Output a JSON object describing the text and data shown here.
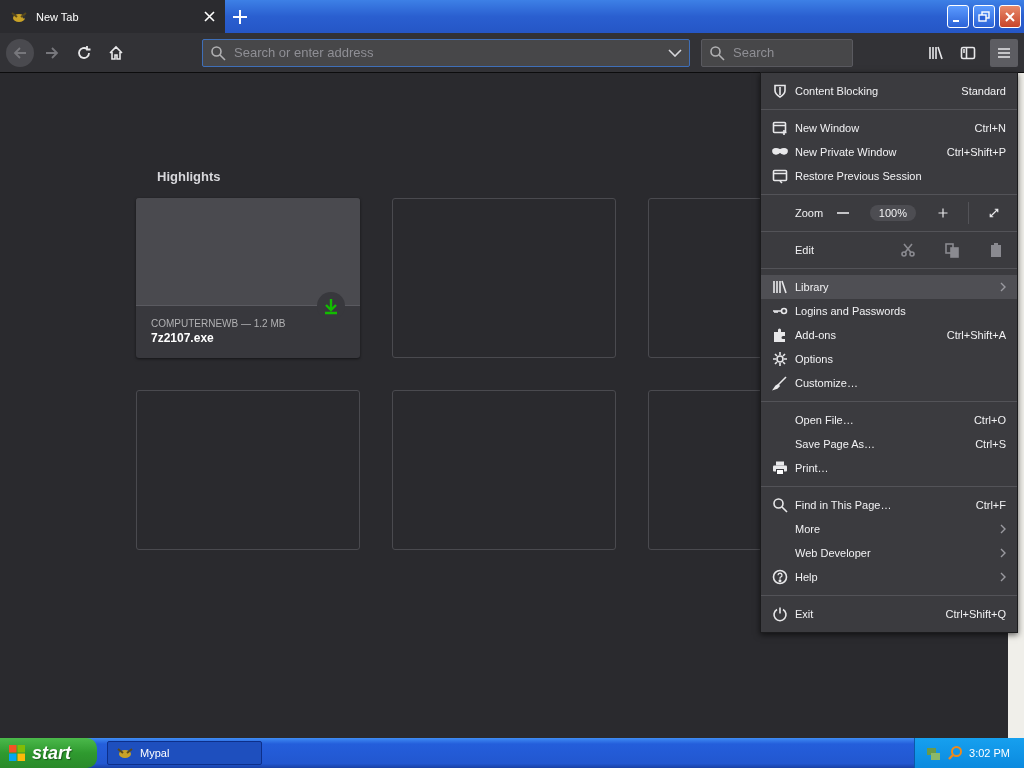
{
  "tabs": [
    {
      "label": "New Tab",
      "selected": true
    }
  ],
  "toolbar": {
    "address": {
      "placeholder": "Search or enter address"
    },
    "search": {
      "placeholder": "Search"
    },
    "menu_open": true
  },
  "highlights": {
    "title": "Highlights",
    "cards": [
      {
        "kind": "download",
        "source": "COMPUTERNEWB — 1.2 MB",
        "title": "7z2107.exe"
      },
      {
        "kind": "empty"
      },
      {
        "kind": "empty"
      },
      {
        "kind": "empty"
      },
      {
        "kind": "empty"
      },
      {
        "kind": "empty"
      }
    ]
  },
  "menu": {
    "sections": [
      [
        {
          "kind": "item",
          "label": "Content Blocking",
          "shortcut": "Standard",
          "submenu": false,
          "hovered": false
        }
      ],
      [
        {
          "kind": "item",
          "label": "New Window",
          "shortcut": "Ctrl+N",
          "submenu": false,
          "hovered": false
        },
        {
          "kind": "item",
          "label": "New Private Window",
          "shortcut": "Ctrl+Shift+P",
          "submenu": false,
          "hovered": false
        },
        {
          "kind": "item",
          "label": "Restore Previous Session",
          "submenu": false,
          "hovered": false
        }
      ],
      [
        {
          "kind": "zoom",
          "label": "Zoom",
          "value": "100%"
        }
      ],
      [
        {
          "kind": "edit",
          "label": "Edit"
        }
      ],
      [
        {
          "kind": "item",
          "label": "Library",
          "submenu": true,
          "hovered": true
        },
        {
          "kind": "item",
          "label": "Logins and Passwords",
          "submenu": false,
          "hovered": false
        },
        {
          "kind": "item",
          "label": "Add-ons",
          "shortcut": "Ctrl+Shift+A",
          "submenu": false,
          "hovered": false
        },
        {
          "kind": "item",
          "label": "Options",
          "submenu": false,
          "hovered": false
        },
        {
          "kind": "item",
          "label": "Customize…",
          "submenu": false,
          "hovered": false
        }
      ],
      [
        {
          "kind": "item",
          "label": "Open File…",
          "shortcut": "Ctrl+O",
          "submenu": false,
          "hovered": false
        },
        {
          "kind": "item",
          "label": "Save Page As…",
          "shortcut": "Ctrl+S",
          "submenu": false,
          "hovered": false
        },
        {
          "kind": "item",
          "label": "Print…",
          "submenu": false,
          "hovered": false
        }
      ],
      [
        {
          "kind": "item",
          "label": "Find in This Page…",
          "shortcut": "Ctrl+F",
          "submenu": false,
          "hovered": false
        },
        {
          "kind": "item",
          "label": "More",
          "submenu": true,
          "hovered": false
        },
        {
          "kind": "item",
          "label": "Web Developer",
          "submenu": true,
          "hovered": false
        },
        {
          "kind": "item",
          "label": "Help",
          "submenu": true,
          "hovered": false
        }
      ],
      [
        {
          "kind": "item",
          "label": "Exit",
          "shortcut": "Ctrl+Shift+Q",
          "submenu": false,
          "hovered": false
        }
      ]
    ]
  },
  "taskbar": {
    "start": "start",
    "tasks": [
      {
        "label": "Mypal"
      }
    ],
    "clock": "3:02 PM"
  }
}
